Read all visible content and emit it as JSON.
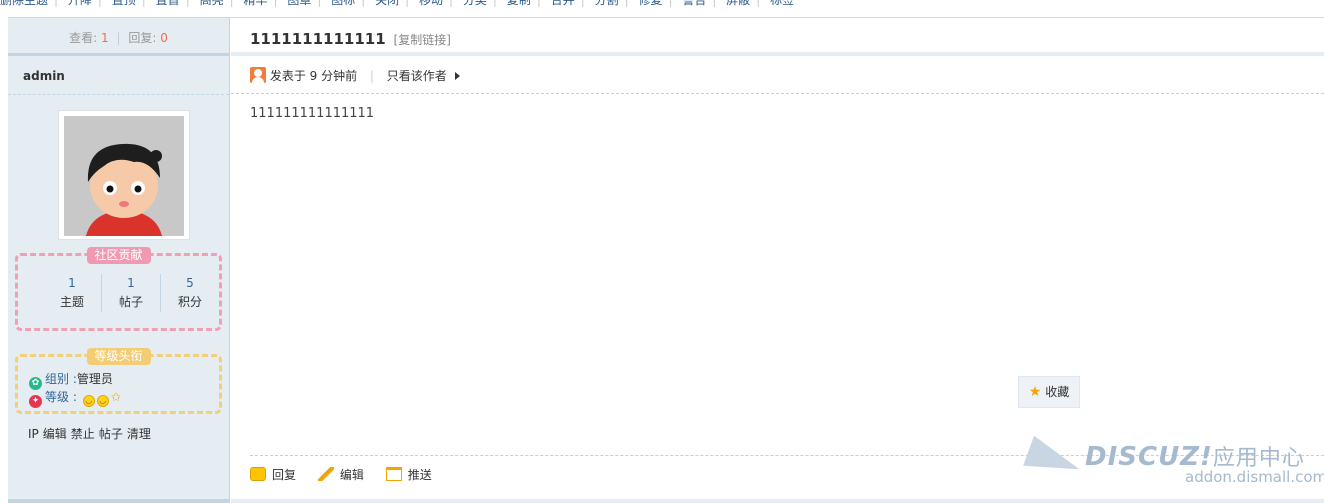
{
  "toolbar": {
    "items": [
      "删除主题",
      "升降",
      "置顶",
      "置首",
      "高亮",
      "精华",
      "图章",
      "图标",
      "关闭",
      "移动",
      "分类",
      "复制",
      "合并",
      "分割",
      "修复",
      "警告",
      "屏蔽",
      "标签"
    ]
  },
  "stats": {
    "views_label": "查看:",
    "views": "1",
    "replies_label": "回复:",
    "replies": "0"
  },
  "author": {
    "name": "admin"
  },
  "contribution": {
    "title": "社区贡献",
    "cells": [
      {
        "value": "1",
        "label": "主题"
      },
      {
        "value": "1",
        "label": "帖子"
      },
      {
        "value": "5",
        "label": "积分"
      }
    ]
  },
  "rank": {
    "title": "等级头衔",
    "group_label": "组别",
    "group_value": "管理员",
    "level_label": "等级"
  },
  "left_actions": [
    "IP",
    "编辑",
    "禁止",
    "帖子",
    "清理"
  ],
  "post": {
    "title": "1111111111111",
    "copy_link": "[复制链接]",
    "posted": "发表于 9 分钟前",
    "only_author": "只看该作者",
    "content": "111111111111111",
    "favorite": "收藏",
    "actions": {
      "reply": "回复",
      "edit": "编辑",
      "push": "推送"
    }
  },
  "watermark": {
    "brand": "DISCUZ!",
    "brand_cn": "应用中心",
    "url": "addon.dismall.com"
  },
  "colors": {
    "sidebar_bg": "#e5edf2",
    "contrib_border": "#f0a0b4",
    "rank_border": "#f2cf7a",
    "link": "#336699",
    "count": "#f26c4f"
  }
}
